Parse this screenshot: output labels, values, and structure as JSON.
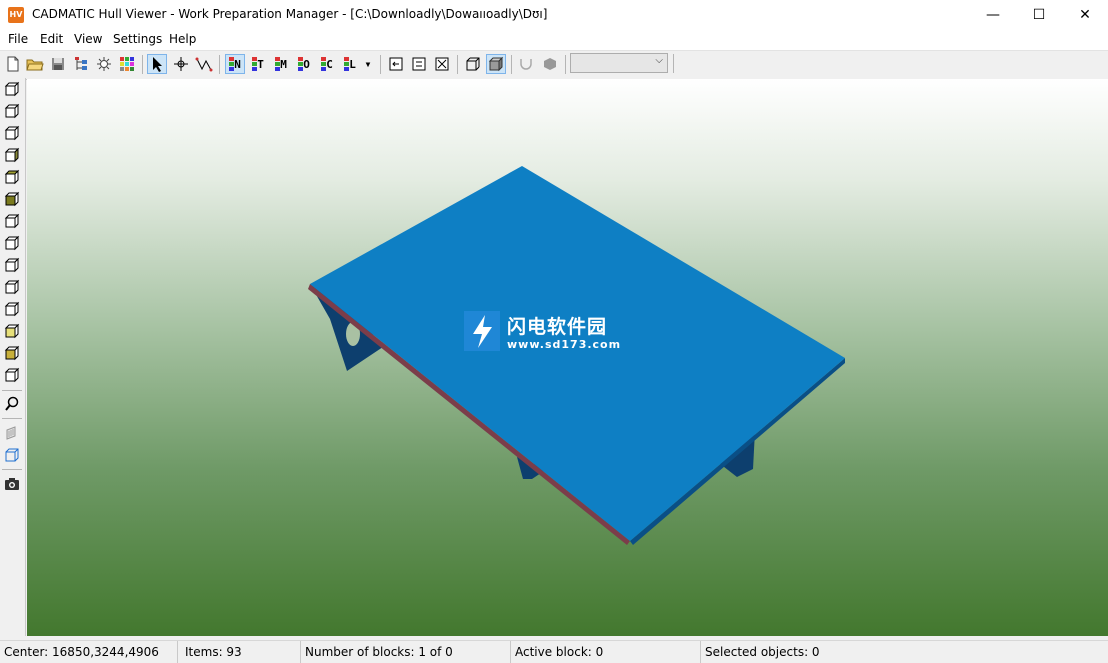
{
  "window": {
    "icon_text": "HV",
    "title": "CADMATIC Hull Viewer - Work Preparation Manager - [C:\\Downloadly\\Dowaııoadly\\Dʊı]",
    "minimize_glyph": "—",
    "maximize_glyph": "☐",
    "close_glyph": "✕"
  },
  "menu": [
    "File",
    "Edit",
    "View",
    "Settings",
    "Help"
  ],
  "toolbar": {
    "view_modes": [
      "N",
      "T",
      "M",
      "O",
      "C",
      "L"
    ],
    "dropdown_arrow": "▾",
    "combo_value": "",
    "combo_arrow": "⌵"
  },
  "left_toolbar": {
    "cube_views": 14
  },
  "watermark": {
    "text": "闪电软件园",
    "url": "www.sd173.com"
  },
  "viewport": {
    "model_color": "#0e7fc4",
    "underside_color": "#0d3f6e"
  },
  "status": {
    "center": "Center: 16850,3244,4906",
    "items": "Items: 93",
    "blocks": "Number of blocks: 1 of 0",
    "active_block": "Active block: 0",
    "selected": "Selected objects: 0"
  }
}
